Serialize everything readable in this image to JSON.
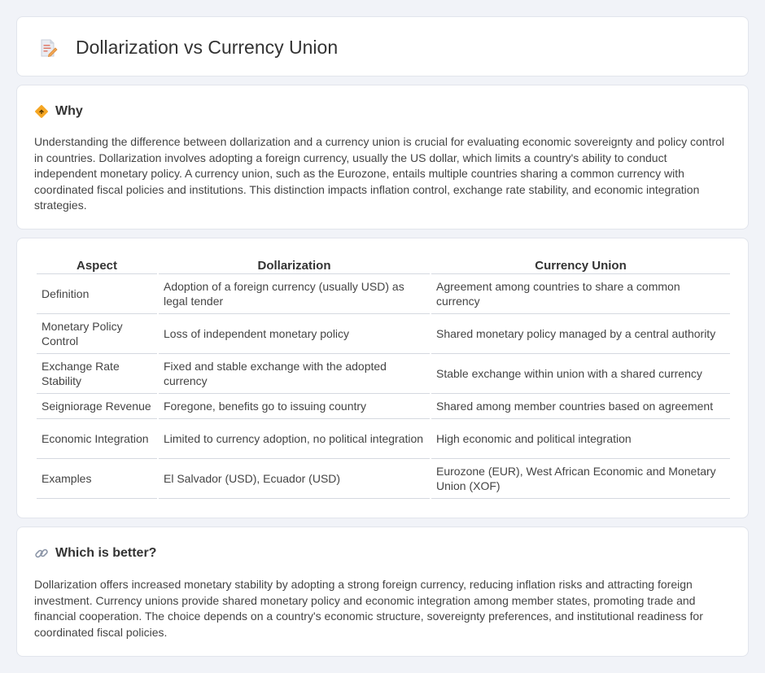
{
  "header": {
    "title": "Dollarization vs Currency Union",
    "icon": "document-pencil-icon"
  },
  "why": {
    "icon": "diamond-sign-icon",
    "title": "Why",
    "body": "Understanding the difference between dollarization and a currency union is crucial for evaluating economic sovereignty and policy control in countries. Dollarization involves adopting a foreign currency, usually the US dollar, which limits a country's ability to conduct independent monetary policy. A currency union, such as the Eurozone, entails multiple countries sharing a common currency with coordinated fiscal policies and institutions. This distinction impacts inflation control, exchange rate stability, and economic integration strategies."
  },
  "table": {
    "headers": [
      "Aspect",
      "Dollarization",
      "Currency Union"
    ],
    "rows": [
      [
        "Definition",
        "Adoption of a foreign currency (usually USD) as legal tender",
        "Agreement among countries to share a common currency"
      ],
      [
        "Monetary Policy Control",
        "Loss of independent monetary policy",
        "Shared monetary policy managed by a central authority"
      ],
      [
        "Exchange Rate Stability",
        "Fixed and stable exchange with the adopted currency",
        "Stable exchange within union with a shared currency"
      ],
      [
        "Seigniorage Revenue",
        "Foregone, benefits go to issuing country",
        "Shared among member countries based on agreement"
      ],
      [
        "Economic Integration",
        "Limited to currency adoption, no political integration",
        "High economic and political integration"
      ],
      [
        "Examples",
        "El Salvador (USD), Ecuador (USD)",
        "Eurozone (EUR), West African Economic and Monetary Union (XOF)"
      ]
    ]
  },
  "better": {
    "icon": "link-icon",
    "title": "Which is better?",
    "body": "Dollarization offers increased monetary stability by adopting a strong foreign currency, reducing inflation risks and attracting foreign investment. Currency unions provide shared monetary policy and economic integration among member states, promoting trade and financial cooperation. The choice depends on a country's economic structure, sovereignty preferences, and institutional readiness for coordinated fiscal policies."
  },
  "colors": {
    "background": "#f1f3f8",
    "card": "#ffffff",
    "accent_orange": "#f5a623"
  }
}
